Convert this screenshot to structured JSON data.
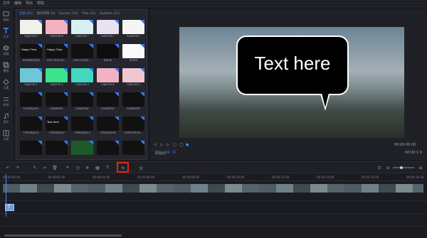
{
  "menu": [
    "文件",
    "编辑",
    "导出",
    "帮助"
  ],
  "sidebar": [
    {
      "label": "媒体",
      "icon": "media-icon",
      "active": false
    },
    {
      "label": "文字",
      "icon": "text-icon",
      "active": true
    },
    {
      "label": "滤镜",
      "icon": "filter-icon",
      "active": false
    },
    {
      "label": "叠加",
      "icon": "overlay-icon",
      "active": false
    },
    {
      "label": "元素",
      "icon": "element-icon",
      "active": false
    },
    {
      "label": "转场",
      "icon": "transition-icon",
      "active": false
    },
    {
      "label": "音乐",
      "icon": "music-icon",
      "active": false
    },
    {
      "label": "分屏",
      "icon": "split-icon",
      "active": false
    }
  ],
  "library": {
    "tabs": [
      "全部 (81)",
      "我的项目 (0)",
      "Opener (10)",
      "Title (41)",
      "Subtitle (21)"
    ],
    "tiles": [
      {
        "label": "Opener6",
        "bg": "#f2f0ea",
        "text": ""
      },
      {
        "label": "Opener8",
        "bg": "#f4b1c0",
        "text": ""
      },
      {
        "label": "Opener7",
        "bg": "#d7f0f4",
        "text": ""
      },
      {
        "label": "Subtitle7",
        "bg": "#e9e2f1",
        "text": ""
      },
      {
        "label": "Subtitle7",
        "bg": "#f5f5f5",
        "text": ""
      },
      {
        "label": "TextNoStyle",
        "bg": "#111",
        "text": "Happy Time"
      },
      {
        "label": "TextThinLin...",
        "bg": "#111",
        "text": "Happy Time"
      },
      {
        "label": "TextThinel...",
        "bg": "#111",
        "text": ""
      },
      {
        "label": "black",
        "bg": "#0d0d0d",
        "text": ""
      },
      {
        "label": "white",
        "bg": "#fafafa",
        "text": ""
      },
      {
        "label": "Opener1",
        "bg": "#6ec7d8",
        "text": ""
      },
      {
        "label": "Opener2",
        "bg": "#3be38c",
        "text": ""
      },
      {
        "label": "Opener3",
        "bg": "#45d8c0",
        "text": ""
      },
      {
        "label": "Opener4",
        "bg": "#f2b2c4",
        "text": ""
      },
      {
        "label": "Opener5",
        "bg": "#f0c7d0",
        "text": ""
      },
      {
        "label": "EndStyle1",
        "bg": "#111",
        "text": ""
      },
      {
        "label": "LowBrd1",
        "bg": "#111",
        "text": ""
      },
      {
        "label": "LowBrd2",
        "bg": "#111",
        "text": ""
      },
      {
        "label": "LowBrd3",
        "bg": "#111",
        "text": ""
      },
      {
        "label": "LowBrd4",
        "bg": "#111",
        "text": ""
      },
      {
        "label": "TitleStyle1",
        "bg": "#111",
        "text": ""
      },
      {
        "label": "TitleStyle2",
        "bg": "#111",
        "text": "Text Here"
      },
      {
        "label": "TitleStyle3",
        "bg": "#111",
        "text": ""
      },
      {
        "label": "TitleStyle4",
        "bg": "#111",
        "text": ""
      },
      {
        "label": "TextLeftTw...",
        "bg": "#111",
        "text": ""
      },
      {
        "label": "",
        "bg": "#111",
        "text": ""
      },
      {
        "label": "",
        "bg": "#111",
        "text": ""
      },
      {
        "label": "",
        "bg": "#1e5a2a",
        "text": ""
      },
      {
        "label": "",
        "bg": "#111",
        "text": ""
      },
      {
        "label": "",
        "bg": "#111",
        "text": ""
      }
    ]
  },
  "preview": {
    "bubble_text": "Text here",
    "zoom_label": "原始比",
    "ratio": "16 : 9",
    "time_current": "00:00:00.00",
    "time_total": "00:00:1 0",
    "split_label": "分"
  },
  "toolbar": {
    "highlighted_tool": "detach-audio-icon"
  },
  "timeline": {
    "ticks": [
      "00:00:00.00",
      "00:00:02.00",
      "00:00:04.00",
      "00:00:06.00",
      "00:00:08.00",
      "00:00:10.00",
      "00:00:12.00",
      "00:00:14.00",
      "00:00:16.00",
      "00:00:18.00"
    ],
    "text_clip_label": "T"
  },
  "colors": {
    "accent": "#3d8cff",
    "highlight": "#e0261b"
  }
}
